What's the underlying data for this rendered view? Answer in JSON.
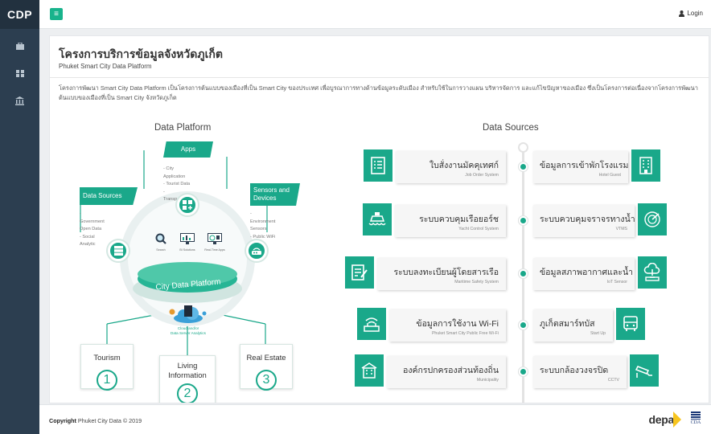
{
  "brand": "CDP",
  "topbar": {
    "login_label": "Login"
  },
  "page": {
    "title_th": "โครงการบริการข้อมูลจังหวัดภูเก็ต",
    "title_en": "Phuket Smart City Data Platform",
    "description": "โครงการพัฒนา Smart City Data Platform เป็นโครงการต้นแบบของเมืองที่เป็น Smart City ของประเทศ เพื่อบูรณาการทางด้านข้อมูลระดับเมือง สำหรับใช้ในการวางแผน บริหารจัดการ และแก้ไขปัญหาของเมือง ซึ่งเป็นโครงการต่อเนื่องจากโครงการพัฒนาต้นแบบของเมืองที่เป็น Smart City จังหวัดภูเก็ต"
  },
  "platform": {
    "heading": "Data Platform",
    "apps_label": "Apps",
    "apps_items": [
      "- City Application",
      "- Tourist Data",
      "- Transportation"
    ],
    "sources_label": "Data Sources",
    "sources_items": [
      "- Government Open Data",
      "- Social Analytic"
    ],
    "sensors_label": "Sensors and Devices",
    "sensors_items": [
      "- Environment Sensors",
      "- Public WiFi"
    ],
    "center_label": "City Data Platform",
    "tiles": [
      "Search",
      "BI Solutions",
      "Real-Time Apps"
    ],
    "cloud_label": "Cloud and/or",
    "cloud_label2": "Data Server Analytics",
    "outputs": [
      {
        "label": "Tourism",
        "num": "1"
      },
      {
        "label": "Living Information",
        "num": "2"
      },
      {
        "label": "Real Estate",
        "num": "3"
      }
    ]
  },
  "sources": {
    "heading": "Data Sources",
    "left": [
      {
        "title": "ใบสั่งงานมัคคุเทศก์",
        "sub": "Job Order System",
        "icon": "document-list-icon"
      },
      {
        "title": "ระบบควบคุมเรือยอร์ช",
        "sub": "Yacht Control System",
        "icon": "ship-icon"
      },
      {
        "title": "ระบบลงทะเบียนผู้โดยสารเรือ",
        "sub": "Maritime Safety System",
        "icon": "register-form-icon"
      },
      {
        "title": "ข้อมูลการใช้งาน Wi-Fi",
        "sub": "Phuket Smart City Public Free Wi-Fi",
        "icon": "wifi-router-icon"
      },
      {
        "title": "องค์กรปกครองส่วนท้องถิ่น",
        "sub": "Municipality",
        "icon": "municipality-building-icon"
      }
    ],
    "right": [
      {
        "title": "ข้อมูลการเข้าพักโรงแรม",
        "sub": "Hotel Guest",
        "icon": "hotel-icon"
      },
      {
        "title": "ระบบควบคุมจราจรทางน้ำ",
        "sub": "VTMS",
        "icon": "radar-icon"
      },
      {
        "title": "ข้อมูลสภาพอากาศและน้ำ",
        "sub": "IoT Sensor",
        "icon": "cloud-sensor-icon"
      },
      {
        "title": "ภูเก็ตสมาร์ทบัส",
        "sub": "Start Up",
        "icon": "bus-icon"
      },
      {
        "title": "ระบบกล้องวงจรปิด",
        "sub": "CCTV",
        "icon": "cctv-icon"
      }
    ]
  },
  "footer": {
    "copyright_bold": "Copyright",
    "copyright_rest": " Phuket City Data © 2019",
    "logo_depa": "depa",
    "logo_cda": "CDA"
  },
  "colors": {
    "accent": "#1aa88a",
    "sidebar": "#2c3e50",
    "menu_button": "#18b38c"
  }
}
